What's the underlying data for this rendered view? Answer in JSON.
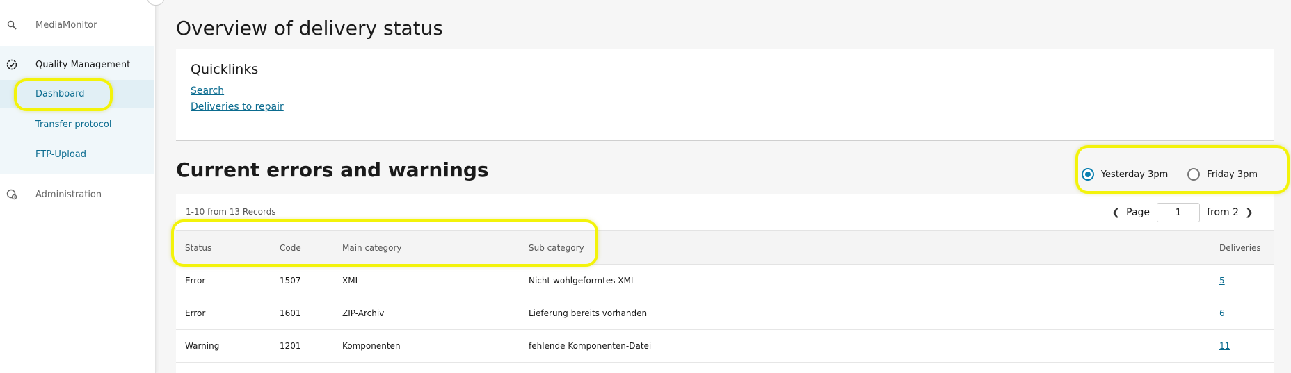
{
  "sidebar": {
    "top_item": "MediaMonitor",
    "quality": "Quality Management",
    "sub_items": [
      "Dashboard",
      "Transfer protocol",
      "FTP-Upload"
    ],
    "admin": "Administration"
  },
  "main": {
    "title": "Overview of delivery status",
    "quicklinks": {
      "title": "Quicklinks",
      "links": [
        "Search",
        "Deliveries to repair"
      ]
    },
    "errors_title": "Current errors and warnings",
    "radios": [
      {
        "label": "Yesterday 3pm",
        "checked": true
      },
      {
        "label": "Friday 3pm",
        "checked": false
      }
    ],
    "table": {
      "records": "1-10 from 13 Records",
      "pager": {
        "page_label": "Page",
        "page_value": "1",
        "from_label": "from 2"
      },
      "headers": [
        "Status",
        "Code",
        "Main category",
        "Sub category",
        "Deliveries"
      ],
      "rows": [
        [
          "Error",
          "1507",
          "XML",
          "Nicht wohlgeformtes XML",
          "5"
        ],
        [
          "Error",
          "1601",
          "ZIP-Archiv",
          "Lieferung bereits vorhanden",
          "6"
        ],
        [
          "Warning",
          "1201",
          "Komponenten",
          "fehlende Komponenten-Datei",
          "11"
        ]
      ]
    }
  },
  "colors": {
    "accent": "#0a6b8f",
    "highlight": "#f3f30a"
  }
}
